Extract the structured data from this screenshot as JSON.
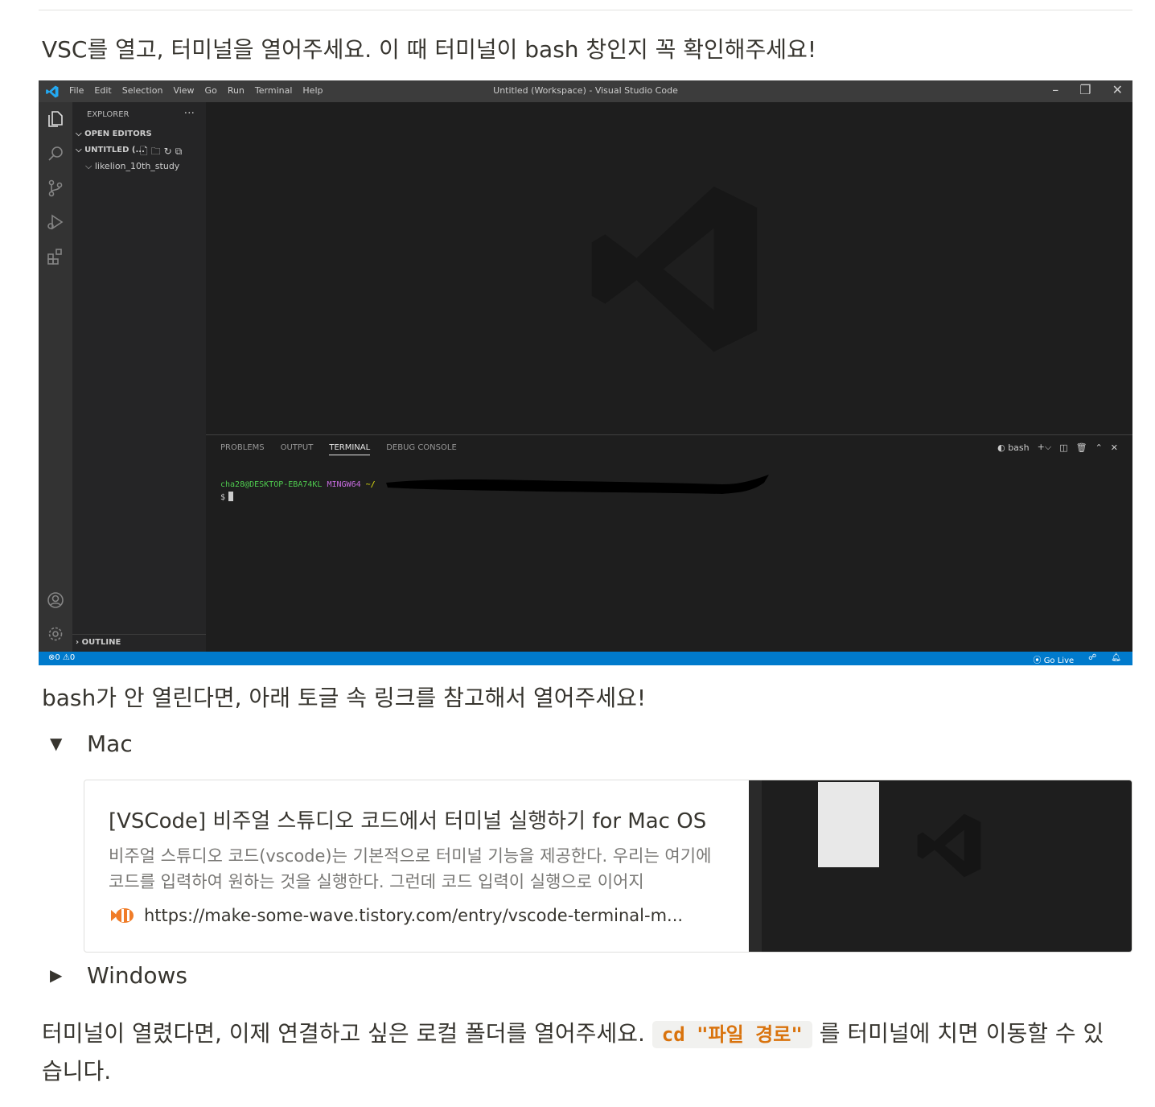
{
  "intro_text": "VSC를 열고, 터미널을 열어주세요. 이 때 터미널이 bash 창인지 꼭 확인해주세요!",
  "vscode": {
    "menu": [
      "File",
      "Edit",
      "Selection",
      "View",
      "Go",
      "Run",
      "Terminal",
      "Help"
    ],
    "window_title": "Untitled (Workspace) - Visual Studio Code",
    "window_controls": [
      "–",
      "❐",
      "✕"
    ],
    "sidebar": {
      "header": "EXPLORER",
      "more": "···",
      "open_editors": "OPEN EDITORS",
      "workspace": "UNTITLED (...",
      "folder": "likelion_10th_study",
      "outline": "OUTLINE"
    },
    "panel": {
      "tabs": [
        "PROBLEMS",
        "OUTPUT",
        "TERMINAL",
        "DEBUG CONSOLE"
      ],
      "active_tab": "TERMINAL",
      "shell": "bash"
    },
    "terminal": {
      "user_host": "cha28@DESKTOP-EBA74KL",
      "env": "MINGW64",
      "path": "~/",
      "prompt": "$"
    },
    "status": {
      "problems": "⊗0 ⚠0",
      "golive": "Go Live"
    }
  },
  "bash_hint_text": "bash가 안 열린다면, 아래 토글 속 링크를 참고해서 열어주세요!",
  "toggles": {
    "mac": {
      "arrow": "▼",
      "label": "Mac"
    },
    "windows": {
      "arrow": "▶",
      "label": "Windows"
    }
  },
  "bookmark": {
    "title": "[VSCode] 비주얼 스튜디오 코드에서 터미널 실행하기 for Mac OS",
    "description": "비주얼 스튜디오 코드(vscode)는 기본적으로 터미널 기능을 제공한다. 우리는 여기에 코드를 입력하여 원하는 것을 실행한다. 그런데 코드 입력이 실행으로 이어지",
    "url": "https://make-some-wave.tistory.com/entry/vscode-terminal-m..."
  },
  "final_text_before": "터미널이 열렸다면, 이제 연결하고 싶은 로컬 폴더를 열어주세요. ",
  "final_code": "cd \"파일 경로\"",
  "final_text_after": " 를 터미널에 치면 이동할 수 있습니다."
}
